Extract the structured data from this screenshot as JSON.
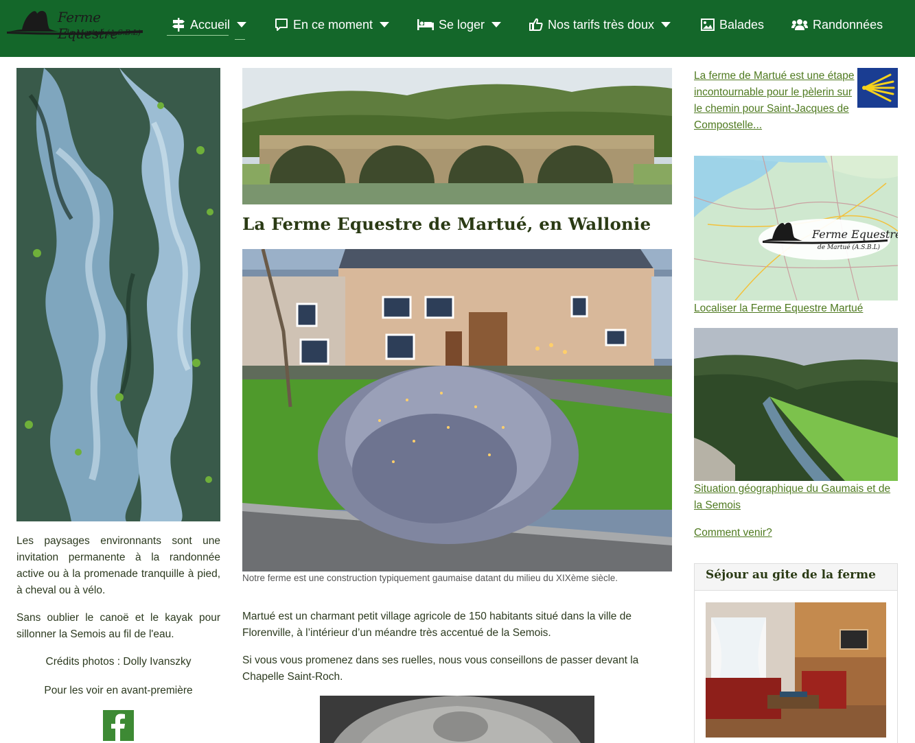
{
  "header": {
    "logo": {
      "title": "Ferme Equestre",
      "subtitle": "de Martué (A.S.B.L)"
    },
    "nav": [
      {
        "label": "Accueil",
        "icon": "signpost-icon",
        "has_dropdown": true,
        "active": true
      },
      {
        "label": "En ce moment",
        "icon": "comment-icon",
        "has_dropdown": true
      },
      {
        "label": "Se loger",
        "icon": "bed-icon",
        "has_dropdown": true
      },
      {
        "label": "Nos tarifs très doux",
        "icon": "thumbs-up-icon",
        "has_dropdown": true
      },
      {
        "label": "Balades",
        "icon": "image-icon",
        "has_dropdown": false
      },
      {
        "label": "Randonnées",
        "icon": "users-icon",
        "has_dropdown": false
      }
    ]
  },
  "left": {
    "image": "frozen-stream-photo",
    "paragraphs": [
      "Les paysages environnants sont une invitation permanente à la randonnée active ou à la promenade tranquille à pied, à cheval ou à vélo.",
      "Sans oublier le canoë et le kayak pour sillonner la Semois au fil de l'eau."
    ],
    "credits": "Crédits photos : Dolly Ivanszky",
    "preview": "Pour les voir en avant-première",
    "social_icon": "facebook-icon"
  },
  "main": {
    "hero_image": "stone-bridge-photo",
    "title": "La Ferme Equestre de Martué, en Wallonie",
    "farm_image": "farm-house-photo",
    "caption": "Notre ferme est une construction typiquement gaumaise datant du milieu du XIXème siècle.",
    "paragraphs": [
      "Martué est un charmant petit village agricole de 150 habitants situé dans la ville de Florenville, à l’intérieur d’un méandre très accentué de la Semois.",
      "Si vous vous promenez dans ses ruelles, nous vous conseillons de passer devant la Chapelle Saint-Roch."
    ],
    "stone_image": "carved-stone-photo"
  },
  "right": {
    "pilgrim_link": "La ferme de Martué est une étape incontournable pour le pèlerin sur le chemin pour Saint-Jacques de Compostelle...",
    "pilgrim_icon": "scallop-shell-icon",
    "map_logo_title": "Ferme Equestre",
    "map_logo_subtitle": "de Martué (A.S.B.L)",
    "map_link": "Localiser la Ferme Equestre Martué",
    "valley_link": "Situation géographique du Gaumais et de la Semois",
    "venir_link": "Comment venir?",
    "gite_title": "Séjour au gite de la ferme"
  },
  "colors": {
    "navbar": "#14672a",
    "link": "#4f7a20",
    "heading": "#2a3a14",
    "body_text": "#2c3a1f"
  }
}
